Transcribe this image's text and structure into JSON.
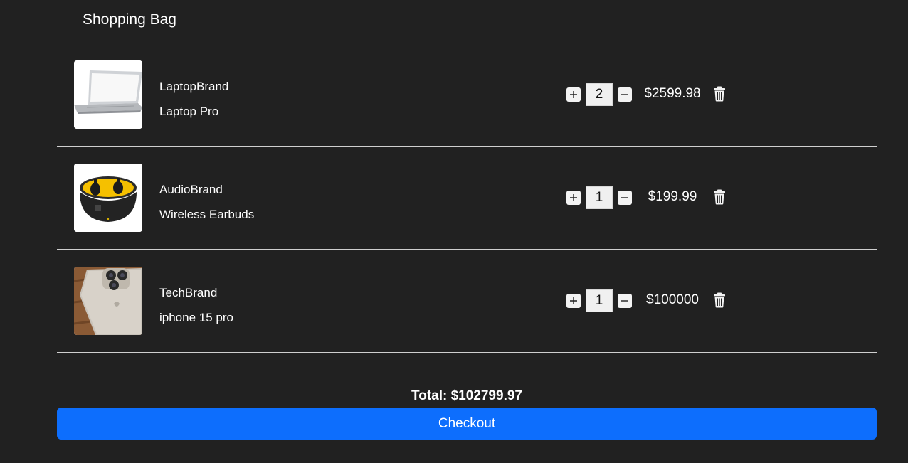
{
  "header": {
    "title": "Shopping Bag"
  },
  "items": [
    {
      "brand": "LaptopBrand",
      "name": "Laptop Pro",
      "quantity": "2",
      "price": "$2599.98",
      "image": "laptop-image"
    },
    {
      "brand": "AudioBrand",
      "name": "Wireless Earbuds",
      "quantity": "1",
      "price": "$199.99",
      "image": "earbuds-image"
    },
    {
      "brand": "TechBrand",
      "name": "iphone 15 pro",
      "quantity": "1",
      "price": "$100000",
      "image": "iphone-image"
    }
  ],
  "summary": {
    "total": "Total: $102799.97"
  },
  "checkout": {
    "label": "Checkout"
  },
  "colors": {
    "background": "#212121",
    "accent": "#0d6efd",
    "divider": "#cfcfcf"
  }
}
